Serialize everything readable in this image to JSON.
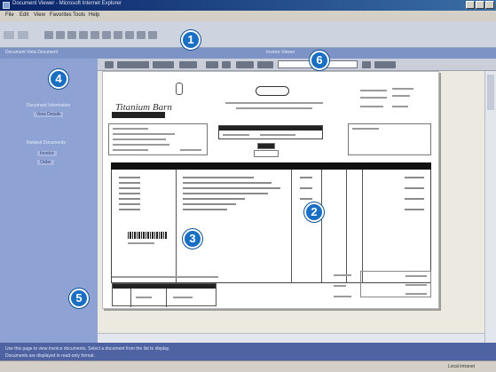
{
  "window": {
    "title": "Document Viewer - Microsoft Internet Explorer",
    "menu": [
      "File",
      "Edit",
      "View",
      "Favorites",
      "Tools",
      "Help"
    ]
  },
  "addressbar": {
    "left_label": "Document   View Document",
    "center_label": "Invoice Viewer"
  },
  "sidebar": {
    "section1_label": "Document Information",
    "section1_link": "View Details",
    "section2_label": "Related Documents",
    "section2_links": [
      "Invoice",
      "Order"
    ]
  },
  "callouts": [
    "1",
    "2",
    "3",
    "4",
    "5",
    "6"
  ],
  "document": {
    "logo_text": "Titanium Barn",
    "barcode_label": "BARCODE"
  },
  "status": {
    "line1": "Use this page to view invoice documents. Select a document from the list to display.",
    "line2": "Documents are displayed in read-only format.",
    "right": "Local intranet"
  },
  "colors": {
    "titlebar": "#0a246a",
    "sidebar": "#8ea3d4",
    "statusbar": "#4f63a3",
    "callout": "#1a6fc2"
  }
}
